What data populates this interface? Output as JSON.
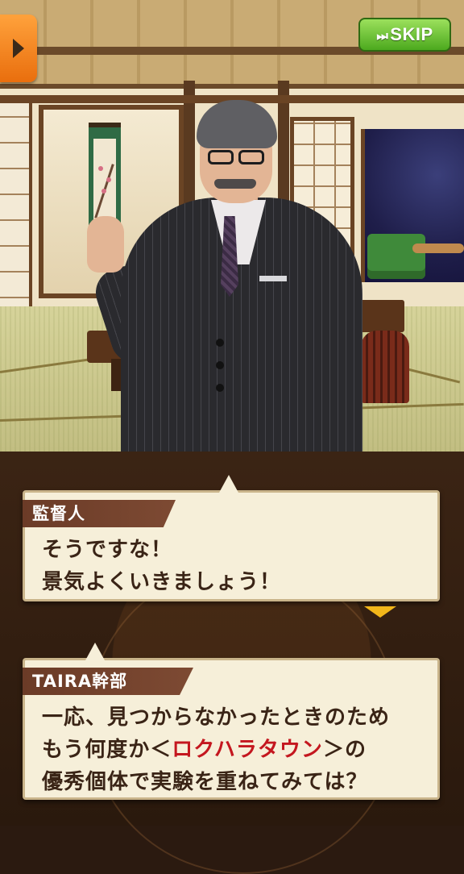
{
  "controls": {
    "menu_icon": "play-triangle-icon",
    "skip_label": "SKIP",
    "skip_icon": "fast-forward-icon"
  },
  "dialogue": [
    {
      "speaker": "監督人",
      "lines": [
        "そうですな！",
        "景気よくいきましょう！"
      ]
    },
    {
      "speaker": "TAIRA幹部",
      "line1": "一応、見つからなかったときのため",
      "line2_before": "もう何度か＜",
      "line2_highlight": "ロクハラタウン",
      "line2_after": "＞の",
      "line3": "優秀個体で実験を重ねてみては？"
    }
  ],
  "colors": {
    "skip_button": "#5bb827",
    "menu_button": "#f28a1f",
    "name_tag": "#74432e",
    "highlight_text": "#c4171f"
  }
}
